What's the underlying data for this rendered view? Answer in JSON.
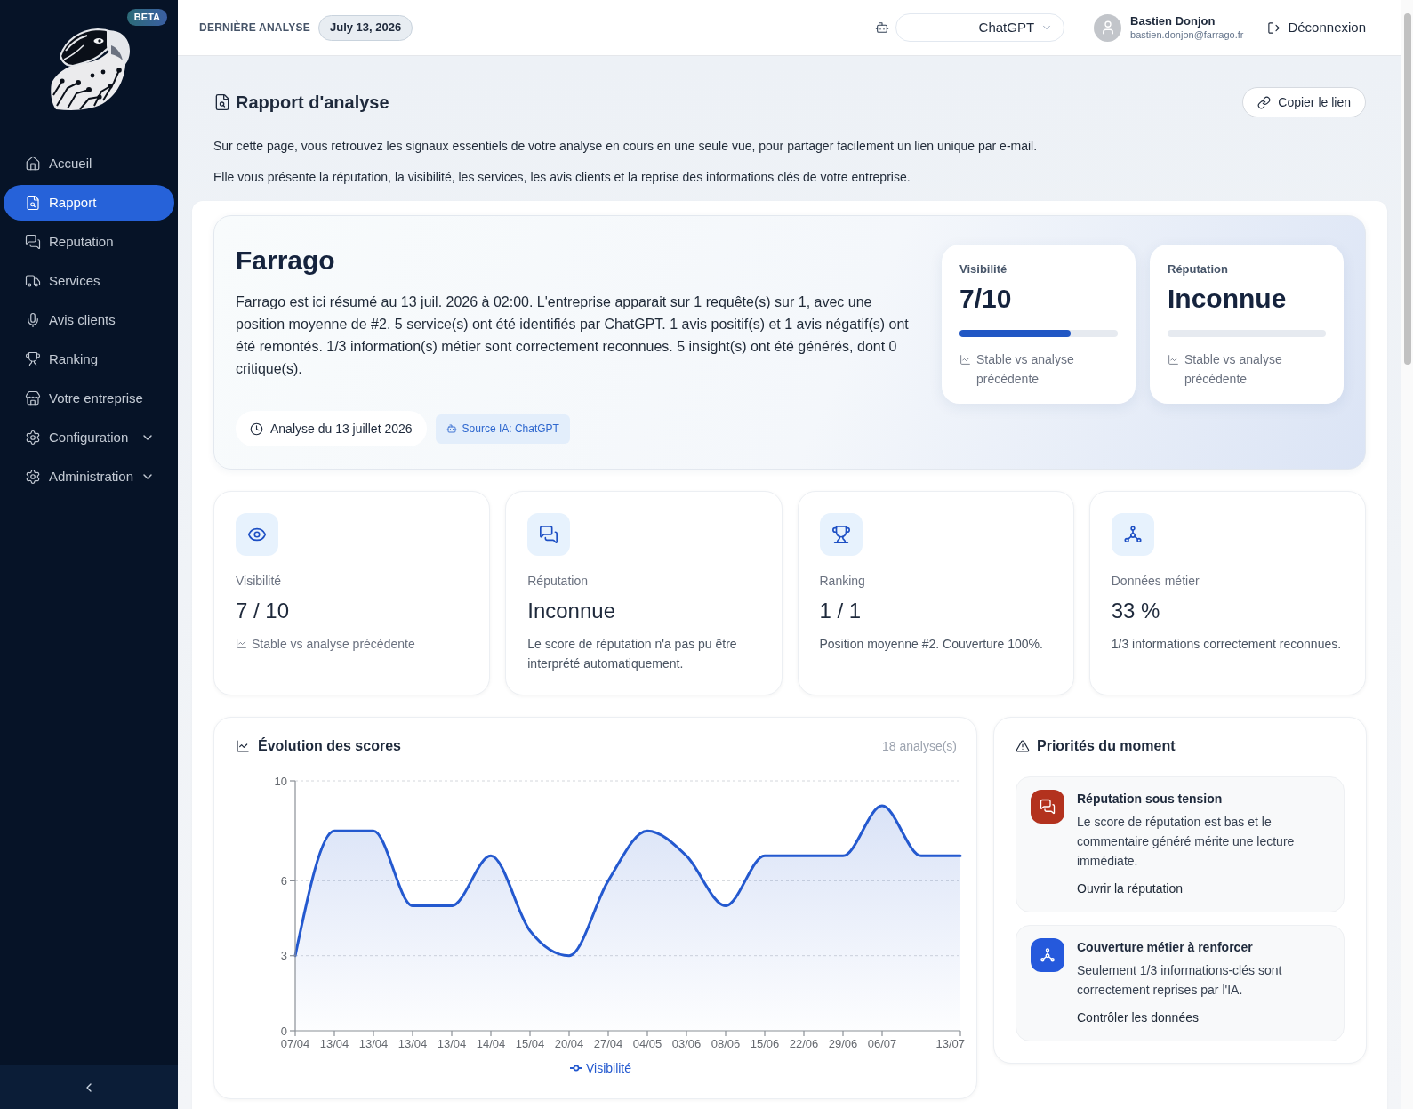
{
  "sidebar": {
    "badge": "BETA",
    "items": [
      {
        "label": "Accueil",
        "kind": "link",
        "selected": false
      },
      {
        "label": "Rapport",
        "kind": "link",
        "selected": true
      },
      {
        "label": "Reputation",
        "kind": "link",
        "selected": false
      },
      {
        "label": "Services",
        "kind": "link",
        "selected": false
      },
      {
        "label": "Avis clients",
        "kind": "link",
        "selected": false
      },
      {
        "label": "Ranking",
        "kind": "link",
        "selected": false
      },
      {
        "label": "Votre entreprise",
        "kind": "link",
        "selected": false
      },
      {
        "label": "Configuration",
        "kind": "group",
        "selected": false,
        "expanded": false
      },
      {
        "label": "Administration",
        "kind": "group",
        "selected": false,
        "expanded": false
      }
    ]
  },
  "header": {
    "label": "DERNIÈRE ANALYSE",
    "date": "July 13, 2026",
    "model_select": {
      "value": "ChatGPT"
    },
    "user": {
      "name": "Bastien Donjon",
      "email": "bastien.donjon@farrago.fr"
    },
    "logout": "Déconnexion"
  },
  "page": {
    "title": "Rapport d'analyse",
    "copy_button": "Copier le lien",
    "intro": [
      "Sur cette page, vous retrouvez les signaux essentiels de votre analyse en cours en une seule vue, pour partager facilement un lien unique par e-mail.",
      "Elle vous présente la réputation, la visibilité, les services, les avis clients et la reprise des informations clés de votre entreprise."
    ]
  },
  "hero": {
    "name": "Farrago",
    "summary": "Farrago est ici résumé au 13 juil. 2026 à 02:00. L'entreprise apparait sur 1 requête(s) sur 1, avec une position moyenne de #2. 5 service(s) ont été identifiés par ChatGPT. 1 avis positif(s) et 1 avis négatif(s) ont été remontés. 1/3 information(s) métier sont correctement reconnues. 5 insight(s) ont été générés, dont 0 critique(s).",
    "date_pill": "Analyse du 13 juillet 2026",
    "source_badge": "Source IA: ChatGPT",
    "scores": [
      {
        "label": "Visibilité",
        "value": "7/10",
        "level": 0.7,
        "trend": "Stable vs analyse précédente"
      },
      {
        "label": "Réputation",
        "value": "Inconnue",
        "trend": "Stable vs analyse précédente"
      }
    ]
  },
  "stats": [
    {
      "label": "Visibilité",
      "value": "7 / 10",
      "note": "Stable vs analyse précédente",
      "kind": "trend"
    },
    {
      "label": "Réputation",
      "value": "Inconnue",
      "note": "Le score de réputation n'a pas pu être interprété automatiquement.",
      "kind": "text"
    },
    {
      "label": "Ranking",
      "value": "1 / 1",
      "note": "Position moyenne #2. Couverture 100%.",
      "kind": "text"
    },
    {
      "label": "Données métier",
      "value": "33 %",
      "note": "1/3 informations correctement reconnues.",
      "kind": "text"
    }
  ],
  "evolution": {
    "count": "18 analyse(s)",
    "chart_data": {
      "type": "area",
      "title": "Évolution des scores",
      "categories": [
        "07/04",
        "13/04",
        "13/04",
        "13/04",
        "13/04",
        "14/04",
        "15/04",
        "20/04",
        "27/04",
        "04/05",
        "03/06",
        "08/06",
        "15/06",
        "22/06",
        "29/06",
        "06/07",
        null,
        "13/07"
      ],
      "ylim": [
        0,
        10
      ],
      "yticks": [
        0,
        3,
        6,
        10
      ],
      "series": [
        {
          "name": "Visibilité",
          "color": "#2459cf",
          "values": [
            3,
            8,
            8,
            5,
            5,
            7,
            4,
            3,
            6,
            8,
            7,
            5,
            7,
            7,
            7,
            9,
            7,
            7
          ]
        }
      ]
    }
  },
  "priorities": {
    "title": "Priorités du moment",
    "items": [
      {
        "title": "Réputation sous tension",
        "text": "Le score de réputation est bas et le commentaire généré mérite une lecture immédiate.",
        "action": "Ouvrir la réputation",
        "color": "#b3321e"
      },
      {
        "title": "Couverture métier à renforcer",
        "text": "Seulement 1/3 informations-clés sont correctement reprises par l'IA.",
        "action": "Contrôler les données",
        "color": "#2559dc"
      }
    ]
  }
}
